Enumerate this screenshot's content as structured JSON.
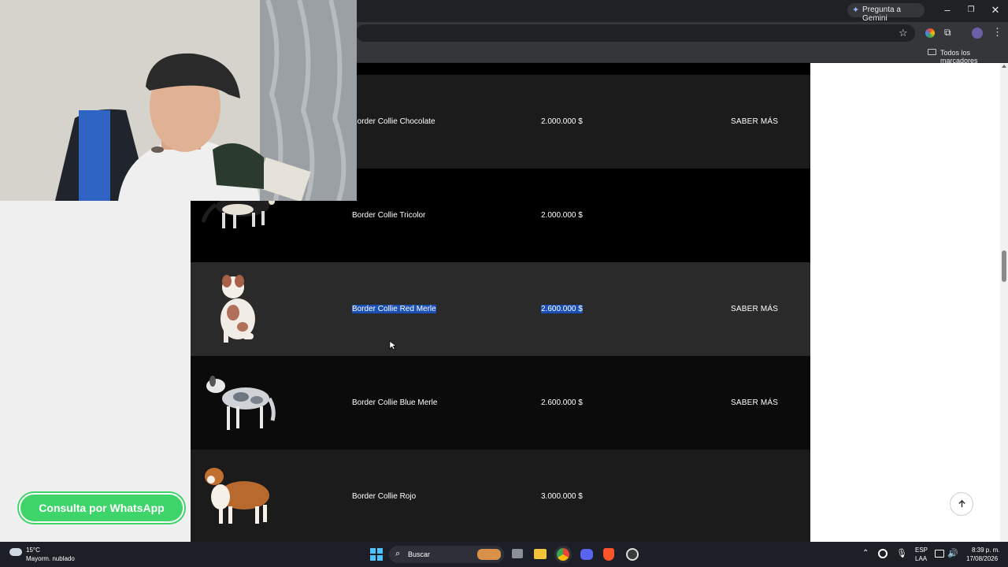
{
  "browser": {
    "gemini_label": "Pregunta a Gemini",
    "bookmarks_label": "Todos los marcadores"
  },
  "products": [
    {
      "name": "Border Collie Chocolate",
      "price": "2.000.000 $",
      "more": "SABER MÁS"
    },
    {
      "name": "Border Collie Tricolor",
      "price": "2.000.000 $",
      "more": ""
    },
    {
      "name": "Border Collie Red Merle",
      "price": "2.600.000 $",
      "more": "SABER MÁS"
    },
    {
      "name": "Border Collie Blue Merle",
      "price": "2.600.000 $",
      "more": "SABER MÁS"
    },
    {
      "name": "Border Collie Rojo",
      "price": "3.000.000 $",
      "more": ""
    }
  ],
  "whatsapp": {
    "label": "Consulta por WhatsApp"
  },
  "taskbar": {
    "weather_temp": "15°C",
    "weather_desc": "Mayorm. nublado",
    "search_label": "Buscar",
    "lang_top": "ESP",
    "lang_bottom": "LAA",
    "time": "8:39 p. m.",
    "date": "17/08/2026"
  }
}
